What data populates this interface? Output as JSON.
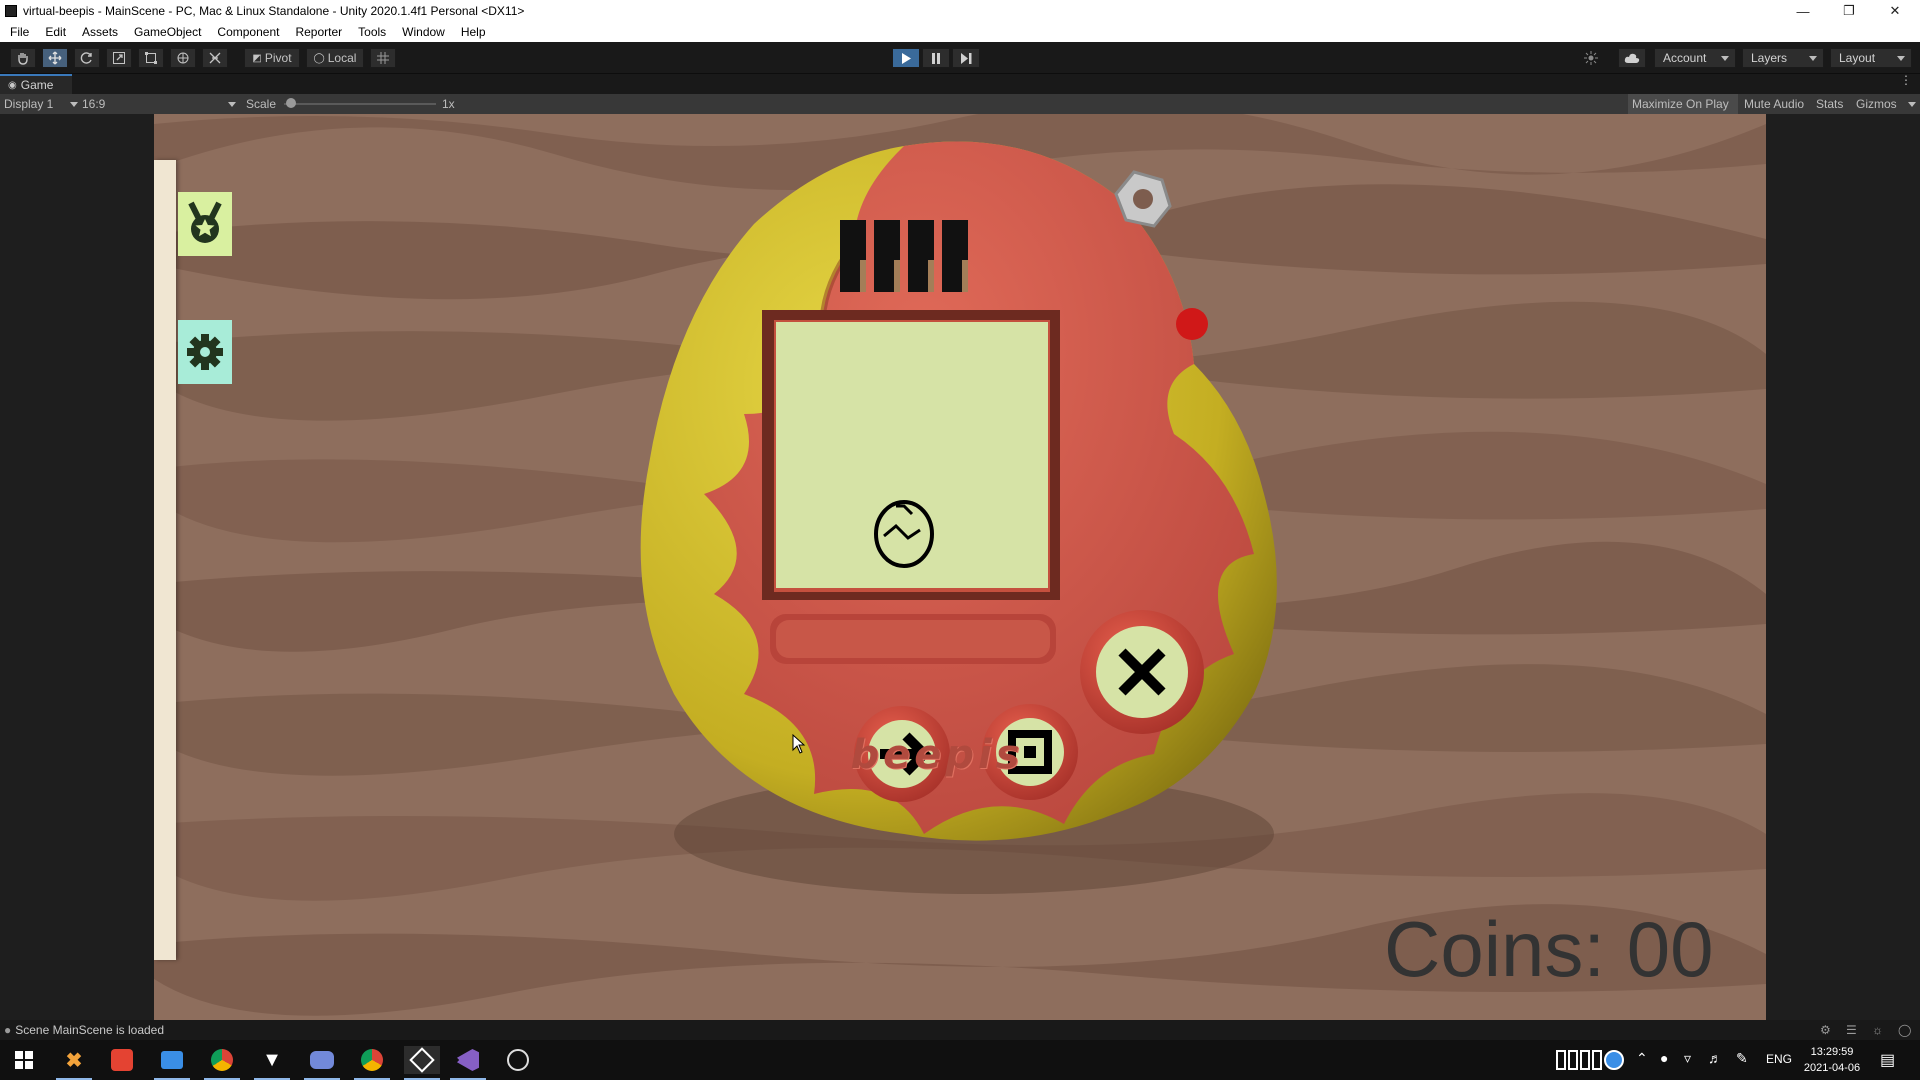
{
  "window": {
    "title": "virtual-beepis - MainScene - PC, Mac & Linux Standalone - Unity 2020.1.4f1 Personal <DX11>"
  },
  "menu": [
    "File",
    "Edit",
    "Assets",
    "GameObject",
    "Component",
    "Reporter",
    "Tools",
    "Window",
    "Help"
  ],
  "toolbar": {
    "pivot_label": "Pivot",
    "local_label": "Local",
    "account_label": "Account",
    "layers_label": "Layers",
    "layout_label": "Layout"
  },
  "game_tab": {
    "label": "Game",
    "display": "Display 1",
    "aspect": "16:9",
    "scale_label": "Scale",
    "scale_value": "1x",
    "maximize_on_play": "Maximize On Play",
    "mute_audio": "Mute Audio",
    "stats": "Stats",
    "gizmos": "Gizmos"
  },
  "game": {
    "coins_text": "Coins: 00",
    "device_brand": "beepis",
    "colors": {
      "background": "#8e6e5d",
      "shell_yellow": "#c9b52a",
      "shell_red": "#d4574a",
      "screen": "#d6e3a6",
      "side_button_a": "#d9f0a0",
      "side_button_b": "#a8ecd8"
    },
    "side_buttons": [
      "medal-icon",
      "gear-icon"
    ],
    "device_buttons": [
      "arrow-right-icon",
      "square-target-icon",
      "close-x-icon"
    ]
  },
  "status": {
    "message": "Scene MainScene is loaded"
  },
  "taskbar": {
    "language": "ENG",
    "time": "13:29:59",
    "date": "2021-04-06"
  }
}
